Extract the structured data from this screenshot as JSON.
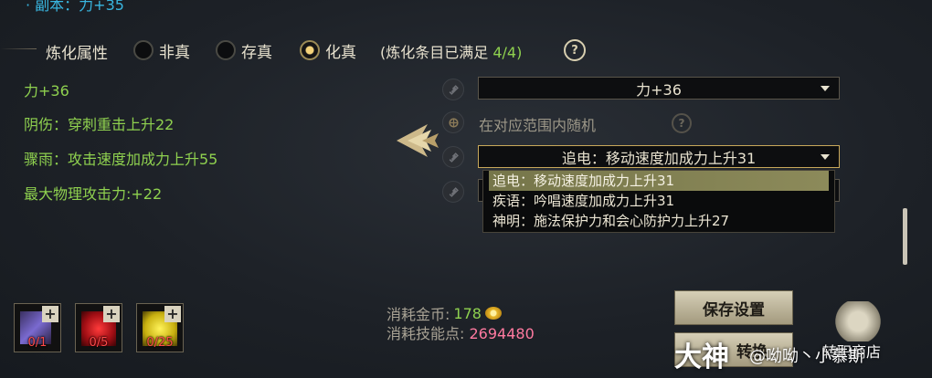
{
  "top_cut_text": "· 副本：力+35",
  "header": {
    "label": "炼化属性",
    "options": [
      {
        "label": "非真",
        "selected": false
      },
      {
        "label": "存真",
        "selected": false
      },
      {
        "label": "化真",
        "selected": true
      }
    ],
    "note_prefix": "(炼化条目已满足",
    "note_count": "4/4)",
    "help": "?"
  },
  "attributes": [
    "力+36",
    "阴伤：穿刺重击上升22",
    "骤雨：攻击速度加成力上升55",
    "最大物理攻击力:+22"
  ],
  "right": {
    "select1": "力+36",
    "random_label": "在对应范围内随机",
    "help": "?",
    "select2": "追电：移动速度加成力上升31",
    "dropdown": [
      "追电：移动速度加成力上升31",
      "疾语：吟唱速度加成力上升31",
      "神明：施法保护力和会心防护力上升27"
    ]
  },
  "materials": [
    {
      "icon": "purple-scroll-icon",
      "qty": "0/1",
      "color": "#5a4aa0"
    },
    {
      "icon": "red-crystal-icon",
      "qty": "0/5",
      "color": "#b0121a"
    },
    {
      "icon": "yellow-crystal-icon",
      "qty": "0/25",
      "color": "#c8b010"
    }
  ],
  "cost": {
    "gold_label": "消耗金币:",
    "gold_value": "178",
    "skill_label": "消耗技能点:",
    "skill_value": "2694480"
  },
  "buttons": {
    "save": "保存设置",
    "convert": "转换"
  },
  "side_button_label": "转职商店",
  "watermark": {
    "big": "大神",
    "handle": "@呦呦丶小慕斯"
  },
  "colors": {
    "accent_green": "#8fd14f",
    "accent_pink": "#ff7aa0",
    "gold": "#e7b628"
  }
}
